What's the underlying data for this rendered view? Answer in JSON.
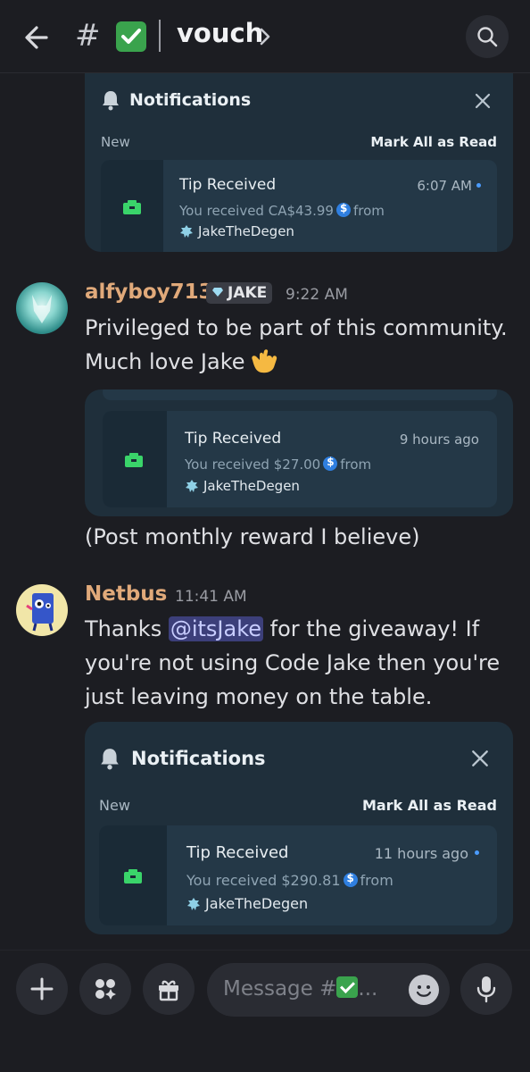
{
  "header": {
    "back_label": "back",
    "hash": "#",
    "channel_name": "vouch",
    "separator": "|"
  },
  "notif_top": {
    "title": "Notifications",
    "new_label": "New",
    "mark_all": "Mark All as Read",
    "item": {
      "title": "Tip Received",
      "time": "6:07 AM",
      "body_prefix": "You received CA$43.99",
      "body_suffix": "from",
      "sender": "JakeTheDegen"
    }
  },
  "message1": {
    "username": "alfyboy713",
    "tag": "JAKE",
    "time": "9:22 AM",
    "text": "Privileged to be part of this community. Much love Jake",
    "emoji": "shaka-emoji",
    "embed": {
      "title": "Tip Received",
      "time": "9 hours ago",
      "body_prefix": "You received $27.00",
      "body_suffix": "from",
      "sender": "JakeTheDegen"
    },
    "followup": "(Post monthly reward I believe)"
  },
  "message2": {
    "username": "Netbus",
    "time": "11:41 AM",
    "text_before": "Thanks ",
    "mention": "@itsJake",
    "text_after": " for the giveaway! If you're not using Code Jake then you're just leaving money on the table.",
    "embed": {
      "title": "Notifications",
      "new_label": "New",
      "mark_all": "Mark All as Read",
      "item": {
        "title": "Tip Received",
        "time": "11 hours ago",
        "body_prefix": "You received $290.81",
        "body_suffix": "from",
        "sender": "JakeTheDegen"
      }
    }
  },
  "composer": {
    "placeholder_prefix": "Message #",
    "placeholder_suffix": "..."
  },
  "colors": {
    "background": "#1c1d22",
    "card": "#1f2f3b",
    "username": "#e0a97a",
    "accent_green": "#3aa34d",
    "coin_blue": "#2f7fe0"
  }
}
